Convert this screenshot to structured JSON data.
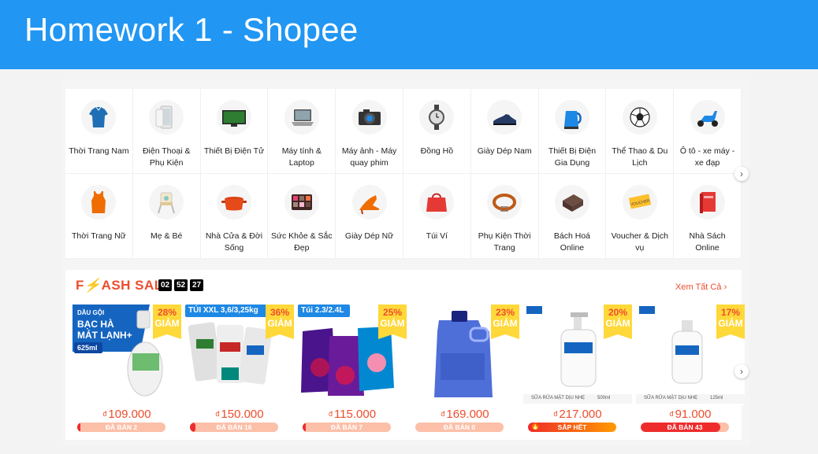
{
  "title": "Homework 1 - Shopee",
  "categories": [
    {
      "label": "Thời Trang Nam",
      "icon": "shirt-icon"
    },
    {
      "label": "Điện Thoại & Phụ Kiện",
      "icon": "phone-icon"
    },
    {
      "label": "Thiết Bị Điện Tử",
      "icon": "tv-icon"
    },
    {
      "label": "Máy tính & Laptop",
      "icon": "laptop-icon"
    },
    {
      "label": "Máy ảnh - Máy quay phim",
      "icon": "camera-icon"
    },
    {
      "label": "Đồng Hồ",
      "icon": "watch-icon"
    },
    {
      "label": "Giày Dép Nam",
      "icon": "mens-shoe-icon"
    },
    {
      "label": "Thiết Bị Điện Gia Dụng",
      "icon": "kettle-icon"
    },
    {
      "label": "Thể Thao & Du Lịch",
      "icon": "soccer-ball-icon"
    },
    {
      "label": "Ô tô - xe máy - xe đạp",
      "icon": "scooter-icon"
    },
    {
      "label": "Thời Trang Nữ",
      "icon": "tank-top-icon"
    },
    {
      "label": "Mẹ & Bé",
      "icon": "high-chair-icon"
    },
    {
      "label": "Nhà Cửa & Đời Sống",
      "icon": "pot-icon"
    },
    {
      "label": "Sức Khỏe & Sắc Đẹp",
      "icon": "palette-icon"
    },
    {
      "label": "Giày Dép Nữ",
      "icon": "heel-icon"
    },
    {
      "label": "Túi Ví",
      "icon": "handbag-icon"
    },
    {
      "label": "Phụ Kiện Thời Trang",
      "icon": "belt-icon"
    },
    {
      "label": "Bách Hoá Online",
      "icon": "chocolate-icon"
    },
    {
      "label": "Voucher & Dịch vụ",
      "icon": "voucher-icon"
    },
    {
      "label": "Nhà Sách Online",
      "icon": "book-icon"
    }
  ],
  "flash_sale": {
    "title_prefix": "F",
    "title_bolt": "⚡",
    "title_rest": "ASH SALE",
    "timer": [
      "02",
      "52",
      "27"
    ],
    "see_all": "Xem Tất Cả",
    "off_label": "GIẢM",
    "currency": "đ",
    "items": [
      {
        "name": "head-shoulders-shampoo",
        "badge": "28%",
        "price": "109.000",
        "sold": "ĐÃ BÁN 2",
        "level": 0.02,
        "hot": false,
        "promo": [
          "DẦU GỘI",
          "BẠC HÀ",
          "MÁT LẠNH+",
          "625ml"
        ]
      },
      {
        "name": "ariel-detergent",
        "badge": "36%",
        "price": "150.000",
        "sold": "ĐÃ BÁN 16",
        "level": 0.06,
        "hot": false,
        "promo": [
          "TÚI XXL 3,6/3,25kg"
        ]
      },
      {
        "name": "downy-softener-bags",
        "badge": "25%",
        "price": "115.000",
        "sold": "ĐÃ BÁN 7",
        "level": 0.03,
        "hot": false,
        "promo": [
          "Túi 2.3/2.4L"
        ]
      },
      {
        "name": "downy-softener-bottle",
        "badge": "23%",
        "price": "169.000",
        "sold": "ĐÃ BÁN 0",
        "level": 0,
        "hot": false,
        "promo": []
      },
      {
        "name": "cetaphil-cleanser-500",
        "badge": "20%",
        "price": "217.000",
        "sold": "SẮP HẾT",
        "level": 1,
        "hot": true,
        "promo": [
          "SỮA RỬA MẶT DỊU NHẸ",
          "500ml"
        ]
      },
      {
        "name": "cetaphil-cleanser-125",
        "badge": "17%",
        "price": "91.000",
        "sold": "ĐÃ BÁN 43",
        "level": 0.9,
        "hot": false,
        "promo": [
          "SỮA RỬA MẶT DỊU NHẸ",
          "125ml"
        ]
      }
    ]
  },
  "nav": {
    "next": "›",
    "see_all_arrow": "›"
  }
}
